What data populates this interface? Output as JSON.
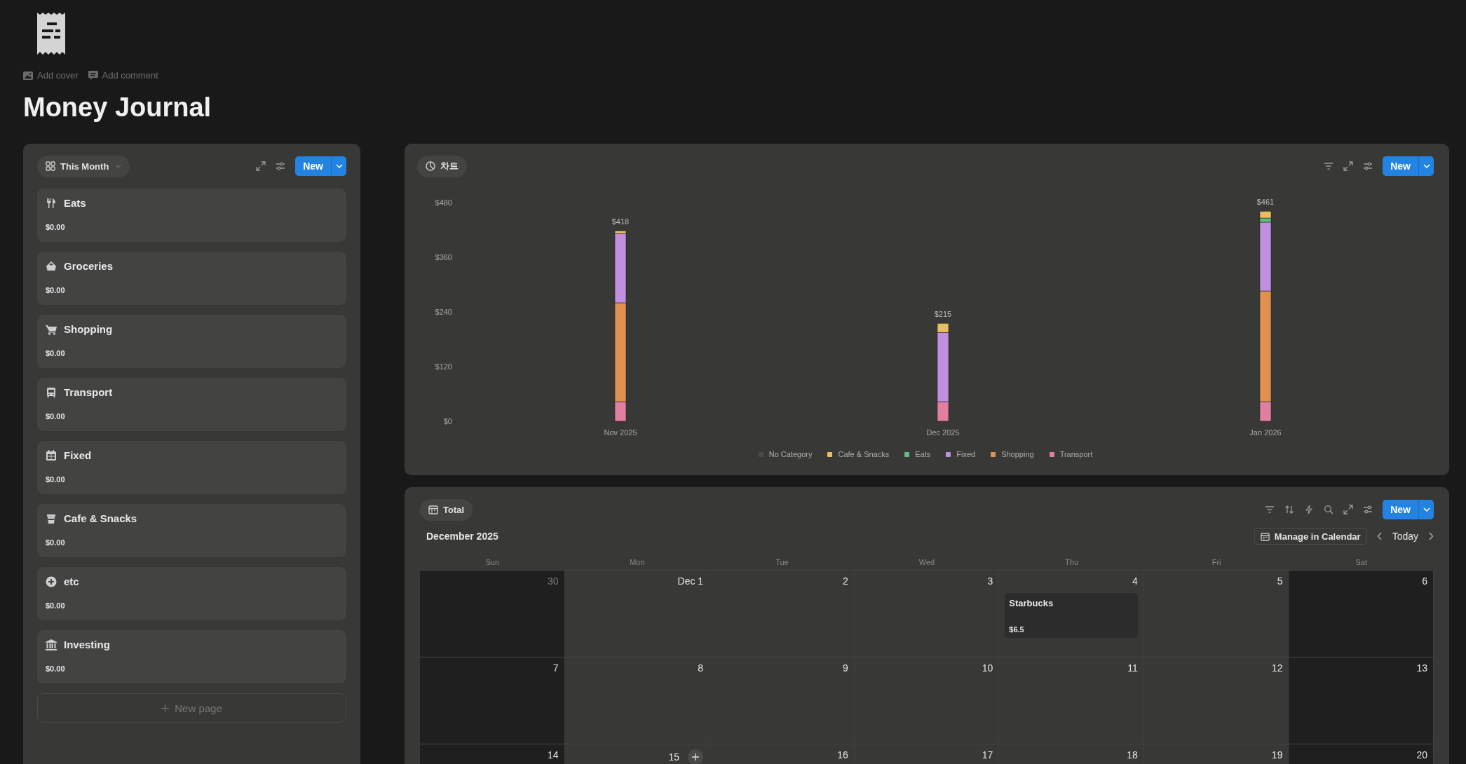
{
  "page": {
    "title": "Money Journal",
    "actions": [
      {
        "kind": "image",
        "label": "Add cover"
      },
      {
        "kind": "comment",
        "label": "Add comment"
      }
    ]
  },
  "categories_view": {
    "view_label": "This Month",
    "new_button": "New",
    "new_page": "New page",
    "cards": [
      {
        "kind": "utensils",
        "title": "Eats",
        "amount": "$0.00"
      },
      {
        "kind": "basket",
        "title": "Groceries",
        "amount": "$0.00"
      },
      {
        "kind": "cart",
        "title": "Shopping",
        "amount": "$0.00"
      },
      {
        "kind": "bus",
        "title": "Transport",
        "amount": "$0.00"
      },
      {
        "kind": "table",
        "title": "Fixed",
        "amount": "$0.00"
      },
      {
        "kind": "cup",
        "title": "Cafe & Snacks",
        "amount": "$0.00"
      },
      {
        "kind": "plus",
        "title": "etc",
        "amount": "$0.00"
      },
      {
        "kind": "bank",
        "title": "Investing",
        "amount": "$0.00"
      }
    ]
  },
  "chart_view": {
    "view_label": "차트",
    "new_button": "New",
    "chart_data": {
      "type": "bar",
      "stacked": true,
      "orientation": "vertical",
      "categories": [
        "Nov 2025",
        "Dec 2025",
        "Jan 2026"
      ],
      "ylim": [
        0,
        480
      ],
      "yticks": [
        {
          "value": 0,
          "label": "$0"
        },
        {
          "value": 120,
          "label": "$120"
        },
        {
          "value": 240,
          "label": "$240"
        },
        {
          "value": 360,
          "label": "$360"
        },
        {
          "value": 480,
          "label": "$480"
        }
      ],
      "value_labels": [
        "$418",
        "$215",
        "$461"
      ],
      "legend": "bottom",
      "series": [
        {
          "name": "No Category",
          "color": "#4a4a4a",
          "values": [
            0,
            0,
            0
          ]
        },
        {
          "name": "Cafe & Snacks",
          "color": "#e9be62",
          "values": [
            6,
            20,
            15
          ]
        },
        {
          "name": "Eats",
          "color": "#5fbf7f",
          "values": [
            0,
            0,
            9
          ]
        },
        {
          "name": "Fixed",
          "color": "#c08fe0",
          "values": [
            152,
            152,
            151
          ]
        },
        {
          "name": "Shopping",
          "color": "#e0914f",
          "values": [
            217,
            0,
            243
          ]
        },
        {
          "name": "Transport",
          "color": "#e07fa0",
          "values": [
            43,
            43,
            43
          ]
        }
      ]
    }
  },
  "calendar_view": {
    "view_label": "Total",
    "new_button": "New",
    "month": "December 2025",
    "manage_button": "Manage in Calendar",
    "today_button": "Today",
    "weekdays": [
      "Sun",
      "Mon",
      "Tue",
      "Wed",
      "Thu",
      "Fri",
      "Sat"
    ],
    "weeks": [
      [
        {
          "label": "30",
          "outside": true
        },
        {
          "label": "Dec 1",
          "outside": false
        },
        {
          "label": "2",
          "outside": false
        },
        {
          "label": "3",
          "outside": false
        },
        {
          "label": "4",
          "outside": false,
          "events": [
            {
              "title": "Starbucks",
              "amount": "$6.5"
            }
          ]
        },
        {
          "label": "5",
          "outside": false
        },
        {
          "label": "6",
          "outside": false
        }
      ],
      [
        {
          "label": "7",
          "outside": false
        },
        {
          "label": "8",
          "outside": false
        },
        {
          "label": "9",
          "outside": false
        },
        {
          "label": "10",
          "outside": false
        },
        {
          "label": "11",
          "outside": false
        },
        {
          "label": "12",
          "outside": false
        },
        {
          "label": "13",
          "outside": false
        }
      ],
      [
        {
          "label": "14",
          "outside": false
        },
        {
          "label": "15",
          "outside": false,
          "add_button": true
        },
        {
          "label": "16",
          "outside": false
        },
        {
          "label": "17",
          "outside": false
        },
        {
          "label": "18",
          "outside": false
        },
        {
          "label": "19",
          "outside": false
        },
        {
          "label": "20",
          "outside": false
        }
      ]
    ]
  }
}
